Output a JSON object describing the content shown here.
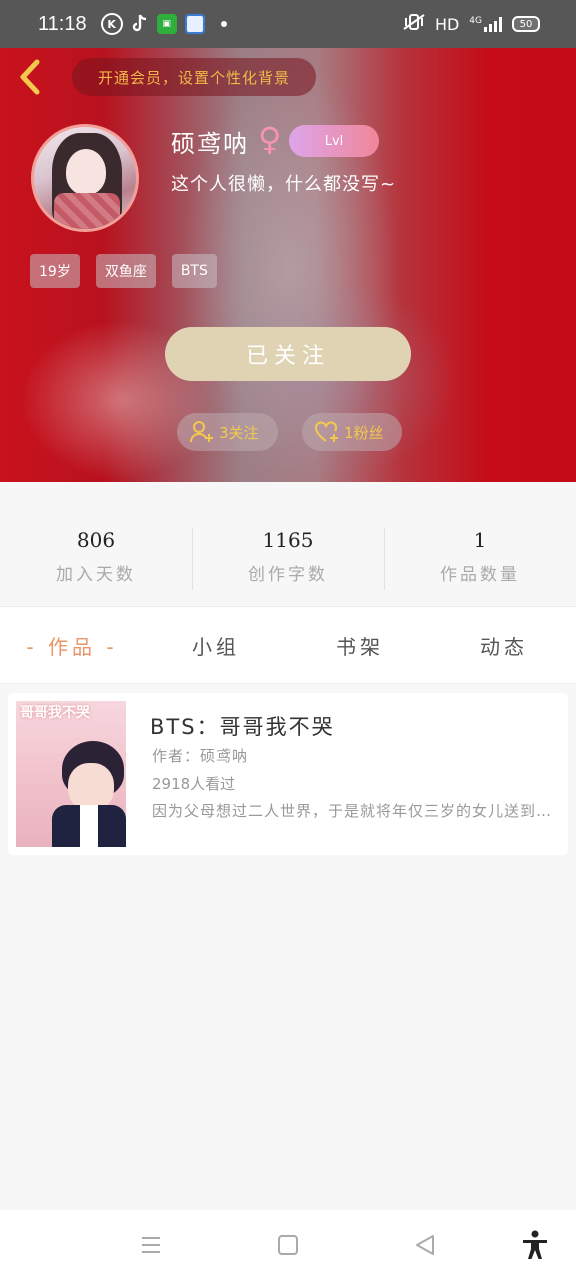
{
  "status_bar": {
    "time": "11:18",
    "network": "HD",
    "signal": "4G",
    "battery": "50"
  },
  "header": {
    "vip_banner": "开通会员，设置个性化背景",
    "username": "硕鸢呐",
    "gender_symbol": "♀",
    "level": "Lvl",
    "bio": "这个人很懒，什么都没写~",
    "tags": [
      "19岁",
      "双鱼座",
      "BTS"
    ],
    "follow_button": "已关注",
    "following_count": "3关注",
    "fans_count": "1粉丝"
  },
  "stats": [
    {
      "value": "806",
      "label": "加入天数"
    },
    {
      "value": "1165",
      "label": "创作字数"
    },
    {
      "value": "1",
      "label": "作品数量"
    }
  ],
  "tabs": [
    {
      "label": "- 作品 -",
      "active": true
    },
    {
      "label": "小组",
      "active": false
    },
    {
      "label": "书架",
      "active": false
    },
    {
      "label": "动态",
      "active": false
    }
  ],
  "works": [
    {
      "cover_text": "哥哥我不哭",
      "title": "BTS：哥哥我不哭",
      "author": "作者：硕鸢呐",
      "views": "2918人看过",
      "desc": "因为父母想过二人世界，于是就将年仅三岁的女儿送到了..."
    }
  ],
  "colors": {
    "header_red": "#c40a16",
    "accent_gold": "#f2c94c",
    "active_tab": "#e8956a",
    "follow_button": "#e0d3b4"
  }
}
